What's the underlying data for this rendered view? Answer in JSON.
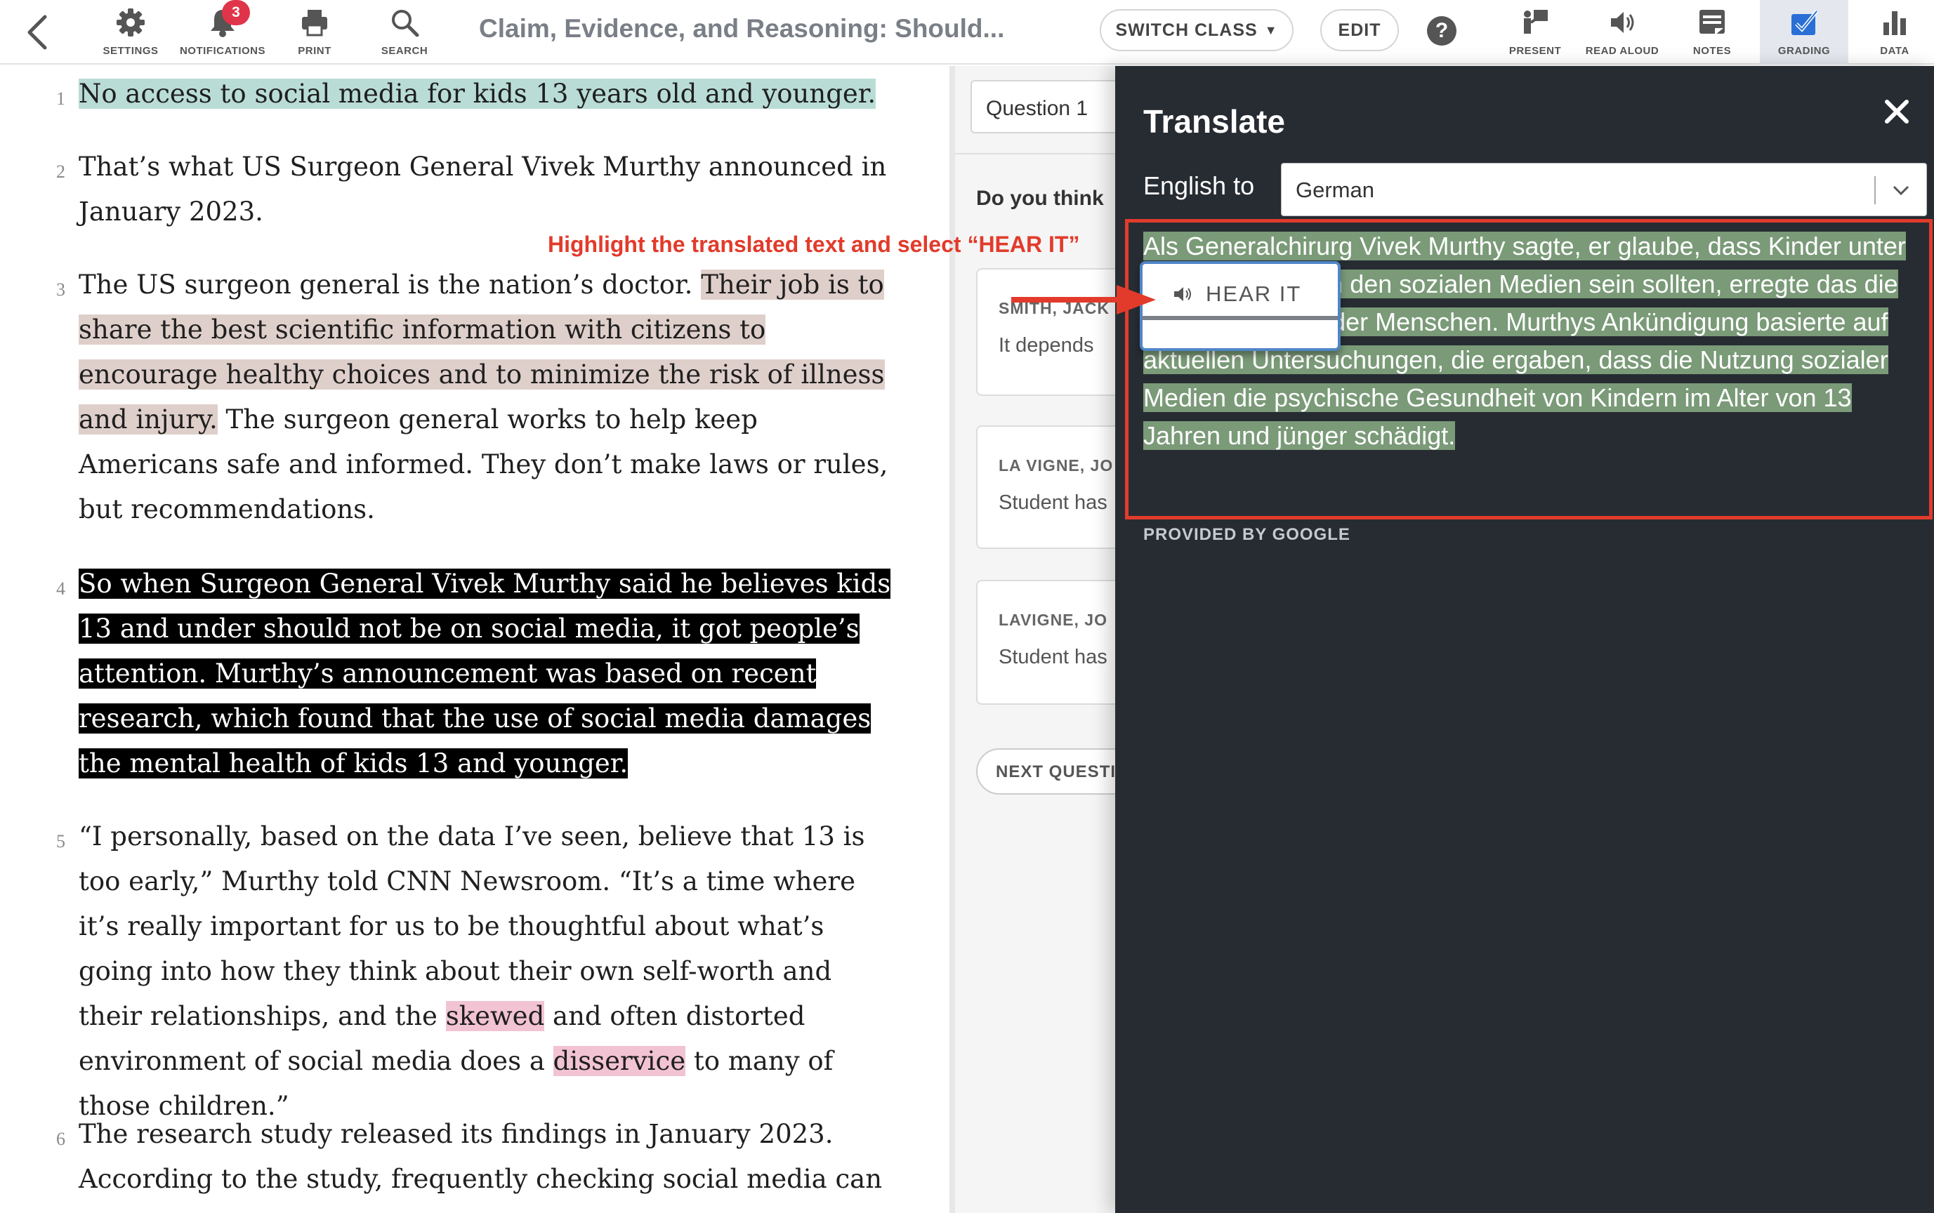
{
  "toolbar": {
    "back_label": "",
    "title": "Claim, Evidence, and Reasoning: Should...",
    "items": {
      "settings": "SETTINGS",
      "notifications": "NOTIFICATIONS",
      "print": "PRINT",
      "search": "SEARCH",
      "present": "PRESENT",
      "read_aloud": "READ ALOUD",
      "notes": "NOTES",
      "grading": "GRADING",
      "data": "DATA"
    },
    "notification_count": "3",
    "switch_class": "SWITCH CLASS",
    "edit": "EDIT",
    "help": "?"
  },
  "article": {
    "paragraphs": [
      {
        "num": "1",
        "parts": [
          "No access to social media for kids 13 years old and younger."
        ]
      },
      {
        "num": "2",
        "parts": [
          "That’s what US Surgeon General Vivek Murthy announced in January 2023."
        ]
      },
      {
        "num": "3",
        "parts": [
          "The US surgeon general is the nation’s doctor. ",
          "Their job is to share the best scientific information with citizens to encourage healthy choices and to minimize the risk of illness and injury.",
          " The surgeon general works to help keep Americans safe and informed. They don’t make laws or rules, but recommendations."
        ]
      },
      {
        "num": "4",
        "parts": [
          "So when Surgeon General Vivek Murthy said he believes kids 13 and under should not be on social media, it got people’s attention. Murthy’s announcement was based on recent research, which found that the use of social media damages the mental health of kids 13 and younger."
        ]
      },
      {
        "num": "5",
        "parts": [
          "“I personally, based on the data I’ve seen, believe that 13 is too early,” Murthy told CNN Newsroom. “It’s a time where it’s really important for us to be thoughtful about what’s going into how they think about their own self-worth and their relationships, and the ",
          "skewed",
          " and often distorted environment of social media does a ",
          "disservice",
          " to many of those children.”"
        ]
      },
      {
        "num": "6",
        "parts": [
          "The research study released its findings in January 2023. According to the study, frequently checking social media can"
        ]
      }
    ]
  },
  "grading": {
    "question_select": "Question 1",
    "question_text": "Do you think",
    "cards": [
      {
        "name": "SMITH, JACK",
        "text": "It depends"
      },
      {
        "name": "LA VIGNE, JO",
        "text": "Student has"
      },
      {
        "name": "LAVIGNE, JO",
        "text": "Student has"
      }
    ],
    "next_button": "NEXT QUESTI"
  },
  "translate": {
    "title": "Translate",
    "close": "×",
    "from_label": "English to",
    "language": "German",
    "translated_text": "Als Generalchirurg Vivek Murthy sagte, er glaube, dass Kinder unter 13 Jahren nicht in den sozialen Medien sein sollten, erregte das die Aufmerksamkeit der Menschen. Murthys Ankündigung basierte auf aktuellen Untersuchungen, die ergaben, dass die Nutzung sozialer Medien die psychische Gesundheit von Kindern im Alter von 13 Jahren und jünger schädigt.",
    "provided_by": "PROVIDED BY GOOGLE",
    "hear_it": "HEAR IT"
  },
  "annotation": {
    "text": "Highlight the translated text and select “HEAR IT”",
    "color": "#e23b2b"
  },
  "colors": {
    "panel_bg": "#272c33",
    "highlight_green": "#b9ddd6",
    "highlight_tan": "#dfcfca",
    "highlight_pink": "#f2c3d3",
    "translated_highlight": "#7a9a78",
    "accent_blue": "#2a6fd6"
  }
}
